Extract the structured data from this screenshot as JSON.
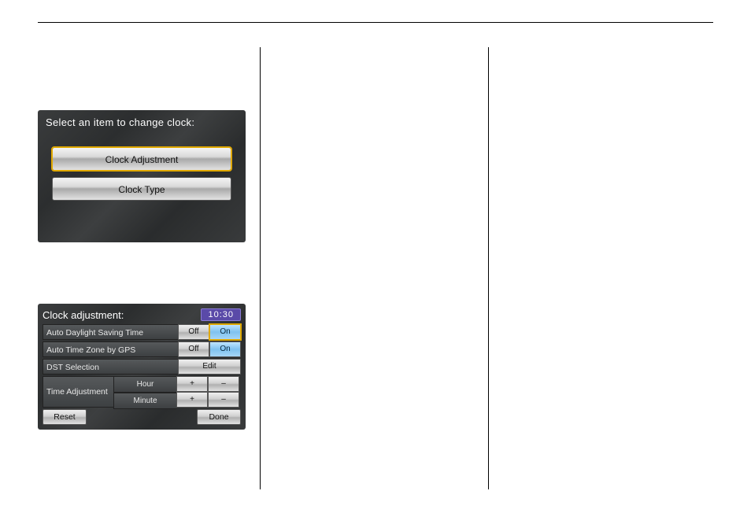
{
  "panel1": {
    "title": "Select an item to change clock:",
    "btn1": "Clock Adjustment",
    "btn2": "Clock Type"
  },
  "panel2": {
    "title": "Clock adjustment:",
    "clock": "10:30",
    "row1": {
      "label": "Auto Daylight Saving Time",
      "off": "Off",
      "on": "On"
    },
    "row2": {
      "label": "Auto Time Zone by GPS",
      "off": "Off",
      "on": "On"
    },
    "row3": {
      "label": "DST Selection",
      "edit": "Edit"
    },
    "ta": {
      "label": "Time Adjustment",
      "hour": "Hour",
      "minute": "Minute",
      "plus": "+",
      "minus": "–"
    },
    "reset": "Reset",
    "done": "Done"
  }
}
